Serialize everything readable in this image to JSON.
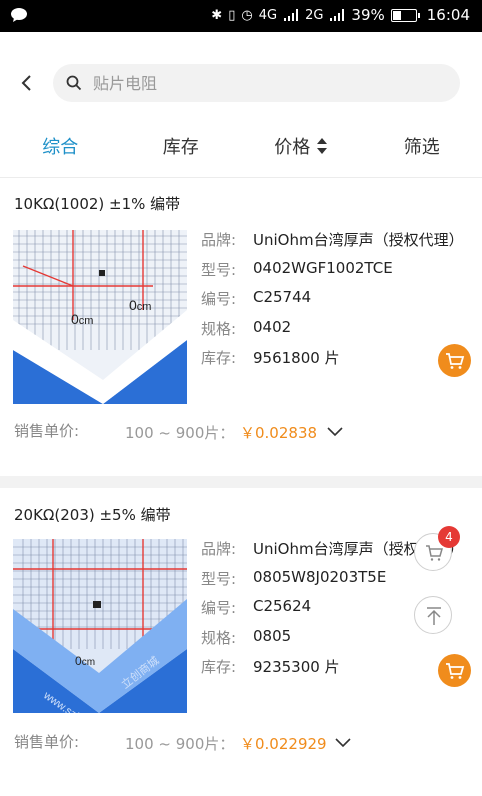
{
  "status_bar": {
    "signal_4g": "4G",
    "signal_2g": "2G",
    "battery_text": "39%",
    "battery_level": 0.39,
    "time": "16:04"
  },
  "header": {
    "search_placeholder": "贴片电阻"
  },
  "tabs": [
    {
      "label": "综合"
    },
    {
      "label": "库存"
    },
    {
      "label": "价格"
    },
    {
      "label": "筛选"
    }
  ],
  "labels": {
    "brand": "品牌:",
    "model": "型号:",
    "code": "编号:",
    "spec": "规格:",
    "stock": "库存:",
    "unit_price": "销售单价:"
  },
  "products": [
    {
      "title": "10KΩ(1002) ±1% 编带",
      "brand": "UniOhm台湾厚声（授权代理）",
      "model": "0402WGF1002TCE",
      "code": "C25744",
      "spec": "0402",
      "stock": "9561800 片",
      "range": "100 ~ 900片：",
      "price": "￥0.02838"
    },
    {
      "title": "20KΩ(203) ±5% 编带",
      "brand": "UniOhm台湾厚声（授权代理）",
      "model": "0805W8J0203T5E",
      "code": "C25624",
      "spec": "0805",
      "stock": "9235300 片",
      "range": "100 ~ 900片：",
      "price": "￥0.022929"
    }
  ],
  "thumb_text": {
    "cm": "cm",
    "zero": "0",
    "watermark_url": "www.szlcsc.com",
    "watermark_cn": "立创商城"
  },
  "floating": {
    "cart_badge": "4"
  },
  "colors": {
    "accent": "#1e90c8",
    "price": "#f08c1c",
    "badge": "#e53935"
  }
}
